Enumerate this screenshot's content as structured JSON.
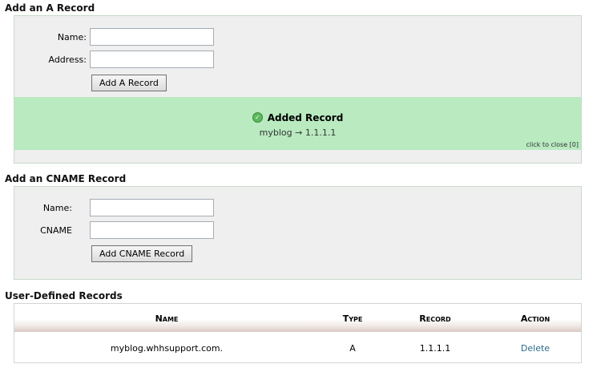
{
  "a_record": {
    "title": "Add an A Record",
    "name_label": "Name:",
    "address_label": "Address:",
    "name_value": "",
    "address_value": "",
    "submit_label": "Add A Record",
    "notice": {
      "title": "Added Record",
      "detail": "myblog → 1.1.1.1",
      "close_label": "click to close [0]",
      "icon": "check-circle-icon"
    }
  },
  "cname_record": {
    "title": "Add an CNAME Record",
    "name_label": "Name:",
    "cname_label": "CNAME",
    "name_value": "",
    "cname_value": "",
    "submit_label": "Add CNAME Record"
  },
  "user_records": {
    "title": "User-Defined Records",
    "columns": [
      "Name",
      "Type",
      "Record",
      "Action"
    ],
    "rows": [
      {
        "name": "myblog.whhsupport.com.",
        "type": "A",
        "record": "1.1.1.1",
        "action": "Delete"
      }
    ]
  },
  "colors": {
    "success_bg": "#b9eac0",
    "panel_bg": "#efefef",
    "link": "#2a6a8a"
  }
}
